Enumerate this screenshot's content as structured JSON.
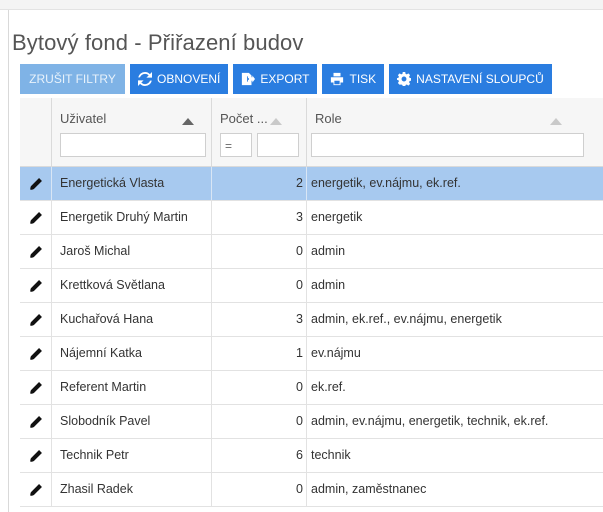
{
  "page": {
    "title": "Bytový fond - Přiřazení budov"
  },
  "toolbar": {
    "clear_filters": "ZRUŠIT FILTRY",
    "refresh": "OBNOVENÍ",
    "export": "EXPORT",
    "print": "TISK",
    "column_settings": "NASTAVENÍ SLOUPCŮ"
  },
  "grid": {
    "columns": [
      "Uživatel",
      "Počet ...",
      "Role"
    ],
    "count_filter_operator": "=",
    "selected_row": 0,
    "rows": [
      {
        "user": "Energetická Vlasta",
        "count": "2",
        "role": "energetik, ev.nájmu, ek.ref."
      },
      {
        "user": "Energetik Druhý Martin",
        "count": "3",
        "role": "energetik"
      },
      {
        "user": "Jaroš Michal",
        "count": "0",
        "role": "admin"
      },
      {
        "user": "Krettková Světlana",
        "count": "0",
        "role": "admin"
      },
      {
        "user": "Kuchařová Hana",
        "count": "3",
        "role": "admin, ek.ref., ev.nájmu, energetik"
      },
      {
        "user": "Nájemní Katka",
        "count": "1",
        "role": "ev.nájmu"
      },
      {
        "user": "Referent Martin",
        "count": "0",
        "role": "ek.ref."
      },
      {
        "user": "Slobodník Pavel",
        "count": "0",
        "role": "admin, ev.nájmu, energetik, technik, ek.ref."
      },
      {
        "user": "Technik Petr",
        "count": "6",
        "role": "technik"
      },
      {
        "user": "Zhasil Radek",
        "count": "0",
        "role": "admin, zaměstnanec"
      }
    ]
  },
  "colors": {
    "primary": "#2a7de0",
    "disabled": "#7fb3e6",
    "selected_row": "#a7c9ef"
  }
}
